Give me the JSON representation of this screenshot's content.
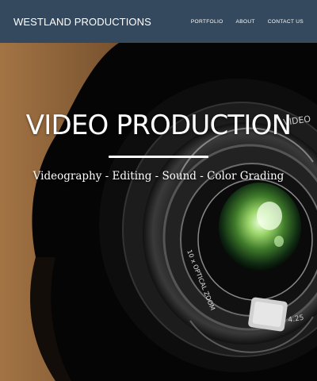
{
  "navbar": {
    "brand": "WESTLAND PRODUCTIONS",
    "links": [
      "PORTFOLIO",
      "ABOUT",
      "CONTACT US"
    ],
    "background": "#34495e"
  },
  "hero": {
    "title": "VIDEO PRODUCTION",
    "subtitle": "Videography - Editing - Sound - Color Grading",
    "lens_text_top": "VIDEO",
    "lens_text_ring": "10 x OPTICAL ZOOM",
    "lens_text_number": "4.25"
  }
}
